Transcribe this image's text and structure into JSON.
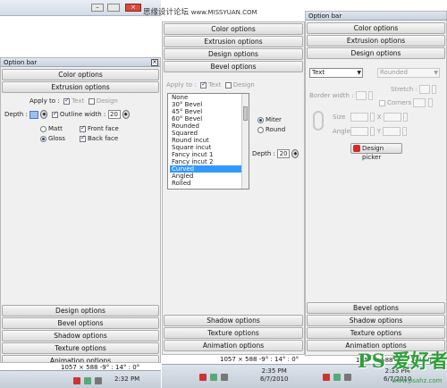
{
  "top": {
    "watermark": "思缘设计论坛",
    "watermark_url": "www.MISSYUAN.COM"
  },
  "left": {
    "title": "Option bar",
    "close": "×",
    "buttons_top": [
      "Color options",
      "Extrusion options"
    ],
    "apply_to_label": "Apply to :",
    "apply_text": "Text",
    "apply_design": "Design",
    "depth_label": "Depth :",
    "outline_width_label": "Outline width :",
    "outline_width_value": "20",
    "matt": "Matt",
    "gloss": "Gloss",
    "front_face": "Front face",
    "back_face": "Back face",
    "buttons_bottom": [
      "Design options",
      "Bevel options",
      "Shadow options",
      "Texture options",
      "Animation options"
    ],
    "status": "1057 × 588  -9° : 14° : 0°",
    "clock_time": "2:32 PM"
  },
  "middle": {
    "buttons_top": [
      "Color options",
      "Extrusion options",
      "Design options",
      "Bevel options"
    ],
    "apply_to_label": "Apply to :",
    "apply_text": "Text",
    "apply_design": "Design",
    "bevel_list": [
      "None",
      "30° Bevel",
      "45° Bevel",
      "60° Bevel",
      "Rounded",
      "Squared",
      "Round incut",
      "Square incut",
      "Fancy incut 1",
      "Fancy incut 2",
      "Curved",
      "Angled",
      "Rolled"
    ],
    "bevel_selected": "Curved",
    "miter": "Miter",
    "round": "Round",
    "depth_label": "Depth :",
    "depth_value": "20",
    "buttons_bottom": [
      "Shadow options",
      "Texture options",
      "Animation options"
    ],
    "status": "1057 × 588  -9° : 14° : 0°",
    "clock_time": "2:35 PM",
    "clock_date": "6/7/2010"
  },
  "right": {
    "title": "Option bar",
    "buttons_top": [
      "Color options",
      "Extrusion options",
      "Design options"
    ],
    "type_select": "Text",
    "shape_select": "Rounded",
    "border_width_label": "Border width :",
    "stretch_label": "Stretch :",
    "corners_label": "Corners",
    "size_label": "Size",
    "angle_label": "Angle",
    "x_label": "X",
    "y_label": "Y",
    "design_picker": "Design picker",
    "buttons_bottom": [
      "Bevel options",
      "Shadow options",
      "Texture options",
      "Animation options"
    ],
    "status": "1057 × 588  -9° : 14° : 0°",
    "clock_time": "2:35 PM",
    "clock_date": "6/7/2010",
    "logo_text": "PS 爱好者",
    "logo_url": "www.psahz.com"
  },
  "colors": {
    "selection": "#3399ff",
    "accent_red": "#d42a2a",
    "logo_green": "#2e9e3a"
  }
}
